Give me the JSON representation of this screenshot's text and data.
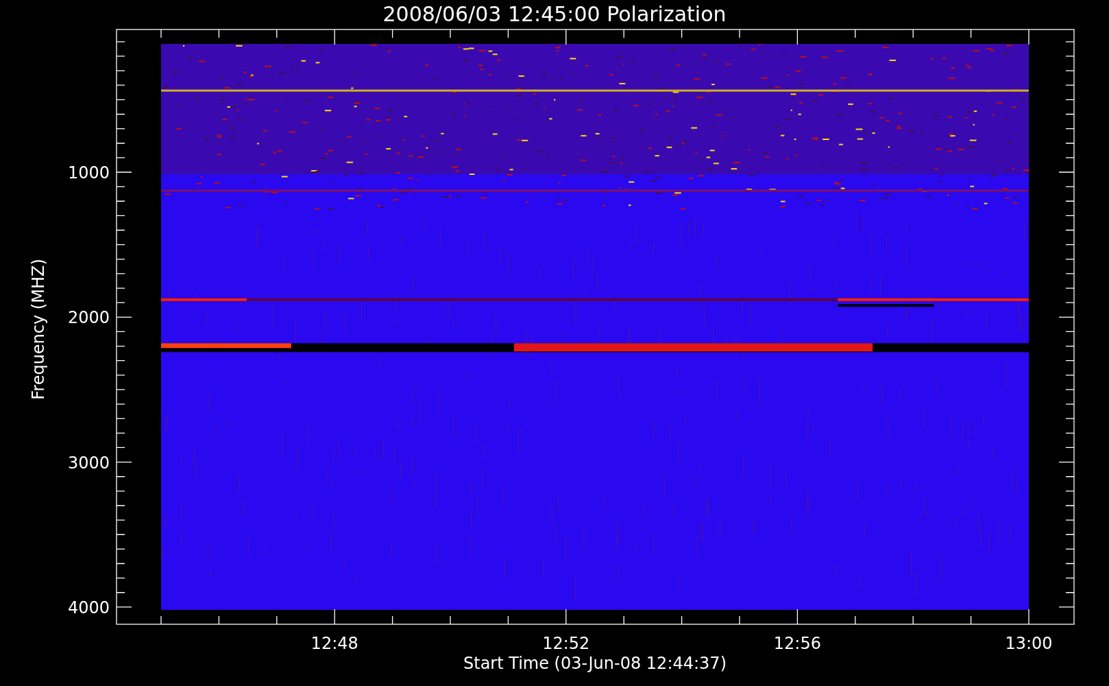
{
  "title": "2008/06/03 12:45:00 Polarization",
  "y_axis": {
    "label": "Frequency (MHZ)",
    "ticks": [
      "1000",
      "2000",
      "3000",
      "4000"
    ]
  },
  "x_axis": {
    "label": "Start Time (03-Jun-08 12:44:37)",
    "ticks": [
      "12:48",
      "12:52",
      "12:56",
      "13:00"
    ]
  }
}
